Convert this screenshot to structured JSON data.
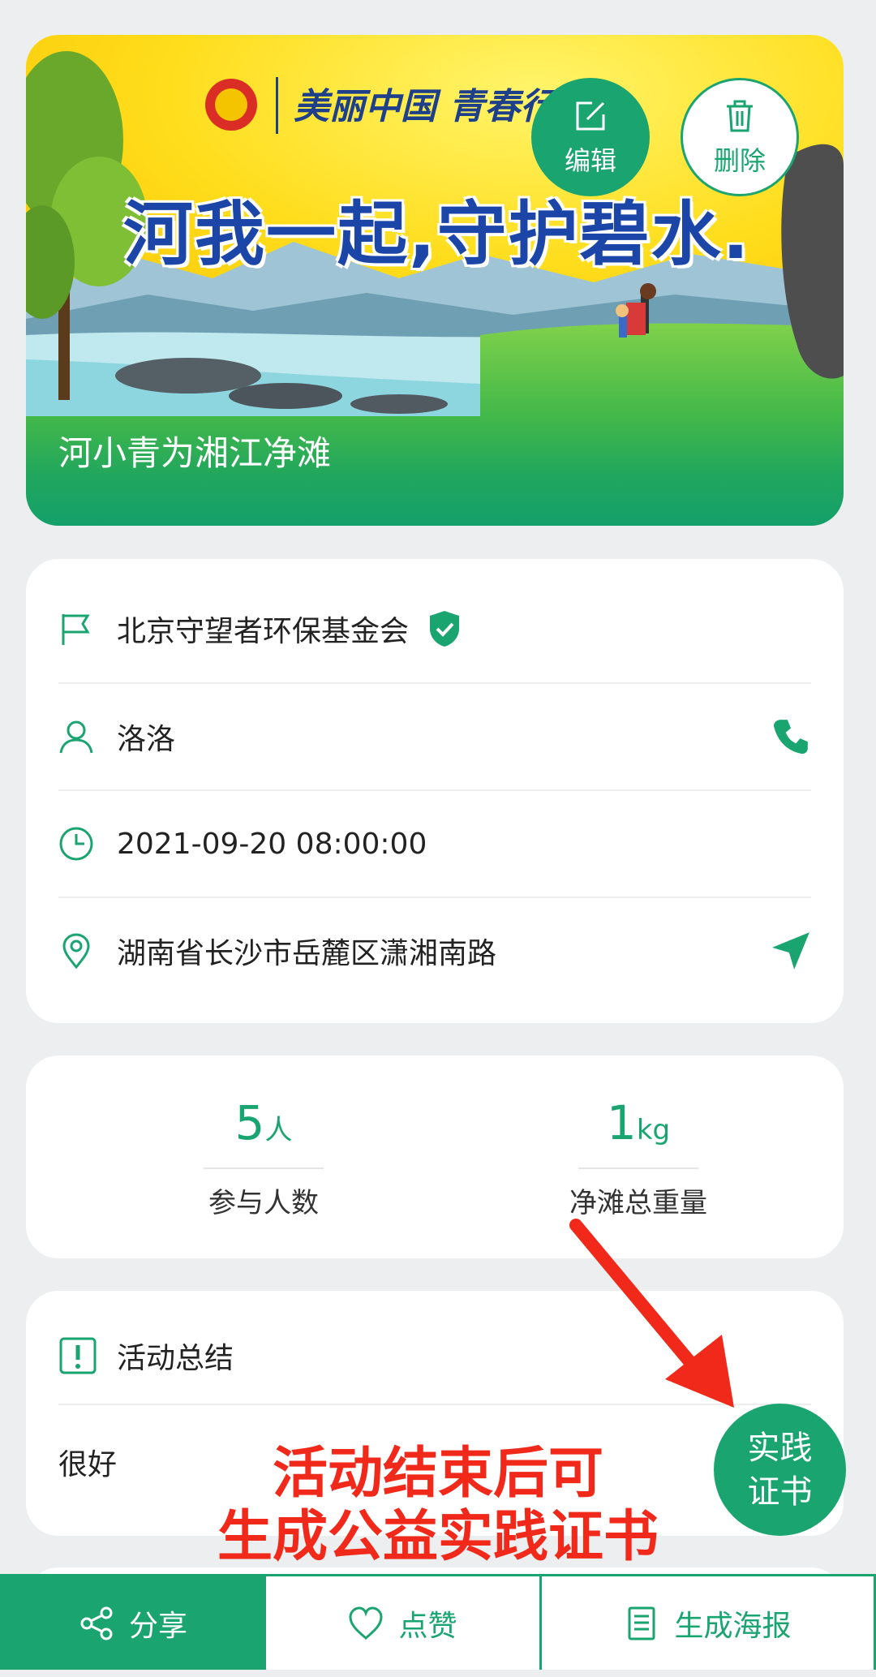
{
  "activity": {
    "poster_logo_text": "美丽中国 青春行",
    "poster_slogan": "河我一起,守护碧水.",
    "title": "河小青为湘江净滩",
    "edit_label": "编辑",
    "delete_label": "删除"
  },
  "info": {
    "organization": "北京守望者环保基金会",
    "contact_name": "洛洛",
    "datetime": "2021-09-20 08:00:00",
    "address": "湖南省长沙市岳麓区潇湘南路"
  },
  "stats": {
    "participants_value": "5",
    "participants_unit": "人",
    "participants_label": "参与人数",
    "weight_value": "1",
    "weight_unit": "kg",
    "weight_label": "净滩总重量"
  },
  "summary": {
    "heading": "活动总结",
    "content": "很好"
  },
  "certificate_button": {
    "line1": "实践",
    "line2": "证书"
  },
  "annotation": {
    "line1": "活动结束后可",
    "line2": "生成公益实践证书"
  },
  "bottom_bar": {
    "share_label": "分享",
    "like_label": "点赞",
    "poster_label": "生成海报"
  },
  "colors": {
    "brand_green": "#1aa570",
    "annotation_red": "#f0291a",
    "background": "#eceeef"
  }
}
